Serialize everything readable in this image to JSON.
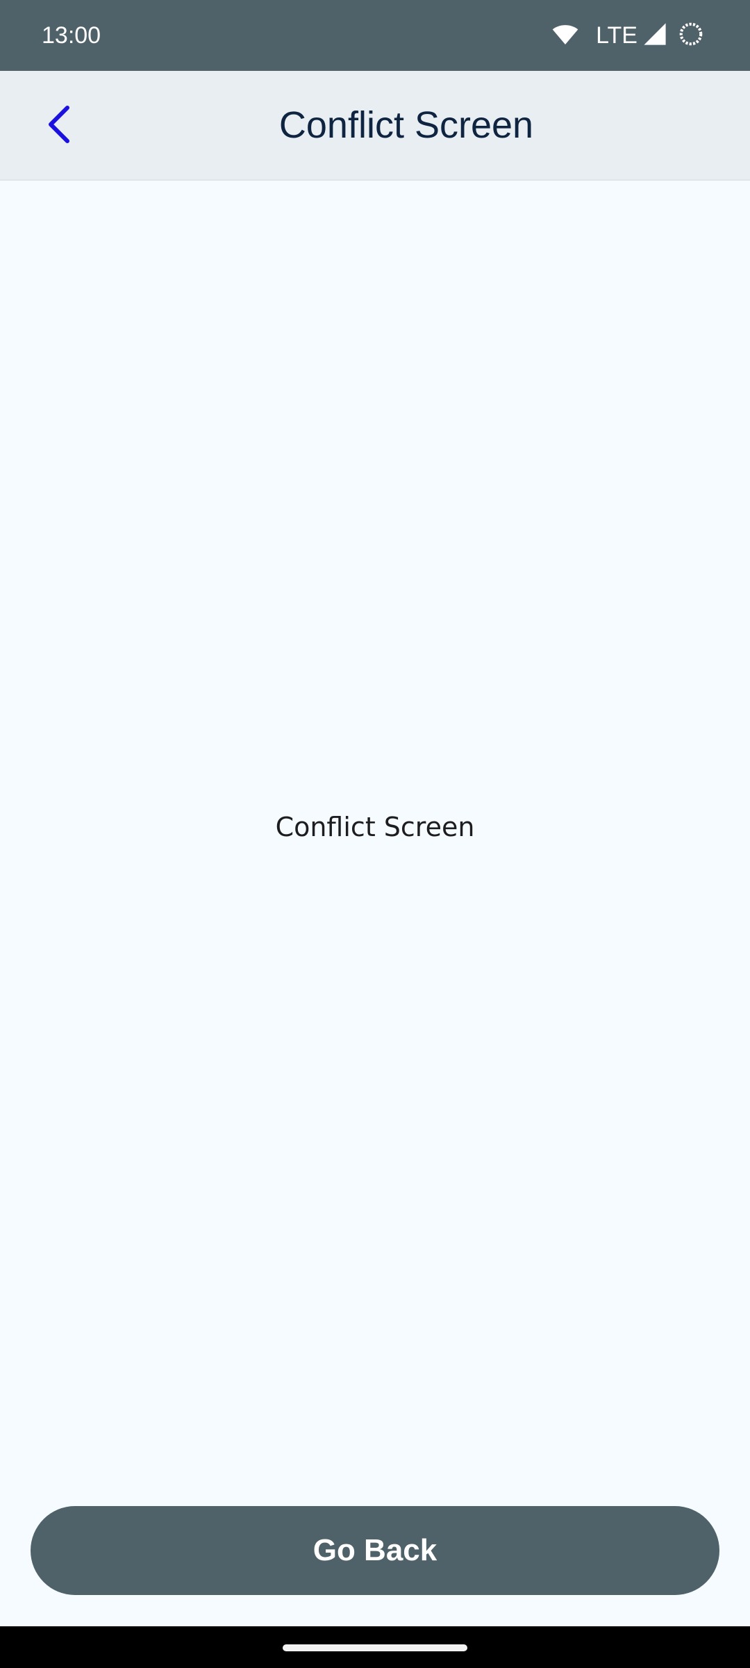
{
  "status_bar": {
    "time": "13:00",
    "network": "LTE",
    "icons": [
      "wifi-icon",
      "signal-icon",
      "battery-icon"
    ]
  },
  "app_bar": {
    "title": "Conflict Screen",
    "back_icon": "chevron-left-icon"
  },
  "main": {
    "label": "Conflict Screen"
  },
  "actions": {
    "go_back_label": "Go Back"
  },
  "colors": {
    "status_bar_bg": "#4f6169",
    "app_bar_bg": "#e8eef2",
    "page_bg": "#f5fbfe",
    "accent": "#1a10e0",
    "title_text": "#0f2440",
    "button_bg": "#4f6169"
  }
}
